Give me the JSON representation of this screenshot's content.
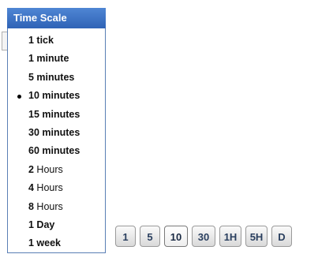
{
  "dropdown": {
    "title": "Time Scale",
    "items": [
      {
        "label": "1 tick",
        "num": "1",
        "unit": " tick",
        "bold_all": false,
        "selected": false
      },
      {
        "label": "1 minute",
        "num": "1",
        "unit": " minute",
        "bold_all": false,
        "selected": false
      },
      {
        "label": "5 minutes",
        "num": "5",
        "unit": " minutes",
        "bold_all": false,
        "selected": false
      },
      {
        "label": "10 minutes",
        "num": "10",
        "unit": " minutes",
        "bold_all": false,
        "selected": true
      },
      {
        "label": "15 minutes",
        "num": "15",
        "unit": " minutes",
        "bold_all": false,
        "selected": false
      },
      {
        "label": "30 minutes",
        "num": "30",
        "unit": " minutes",
        "bold_all": false,
        "selected": false
      },
      {
        "label": "60 minutes",
        "num": "60",
        "unit": " minutes",
        "bold_all": false,
        "selected": false
      },
      {
        "label": "2 Hours",
        "num": "2",
        "unit": " Hours",
        "bold_all": false,
        "selected": false
      },
      {
        "label": "4 Hours",
        "num": "4",
        "unit": " Hours",
        "bold_all": false,
        "selected": false
      },
      {
        "label": "8 Hours",
        "num": "8",
        "unit": " Hours",
        "bold_all": false,
        "selected": false
      },
      {
        "label": "1 Day",
        "num": "1",
        "unit": " Day",
        "bold_all": false,
        "selected": false
      },
      {
        "label": "1 week",
        "num": "1",
        "unit": " week",
        "bold_all": false,
        "selected": false
      }
    ]
  },
  "quick_buttons": [
    {
      "label": "1",
      "active": false
    },
    {
      "label": "5",
      "active": false
    },
    {
      "label": "10",
      "active": true
    },
    {
      "label": "30",
      "active": false
    },
    {
      "label": "1H",
      "active": false
    },
    {
      "label": "5H",
      "active": false
    },
    {
      "label": "D",
      "active": false
    }
  ],
  "colors": {
    "header_bg": "#3a70c4",
    "header_text": "#ffffff",
    "button_text": "#2a3f5f"
  }
}
